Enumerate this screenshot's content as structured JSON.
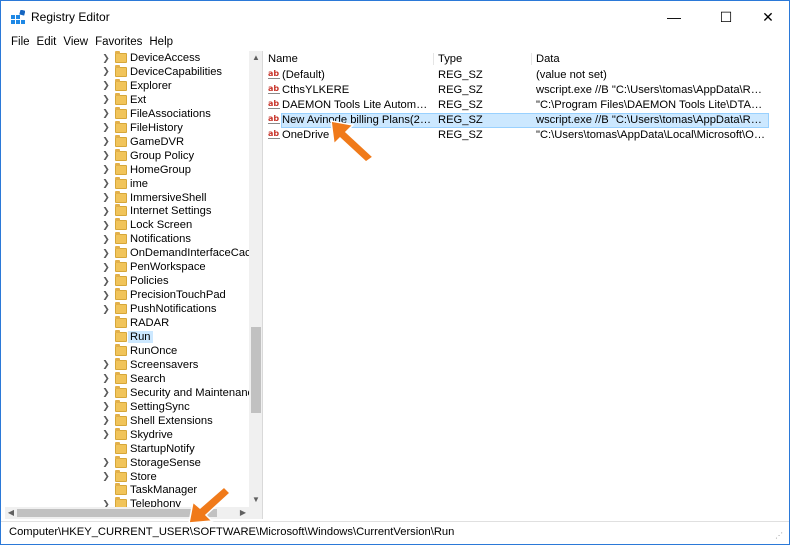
{
  "window": {
    "title": "Registry Editor",
    "minimize_glyph": "—",
    "maximize_glyph": "☐",
    "close_glyph": "✕"
  },
  "menu": [
    "File",
    "Edit",
    "View",
    "Favorites",
    "Help"
  ],
  "tree": {
    "items": [
      {
        "label": "DeviceAccess",
        "expandable": true
      },
      {
        "label": "DeviceCapabilities",
        "expandable": true
      },
      {
        "label": "Explorer",
        "expandable": true
      },
      {
        "label": "Ext",
        "expandable": true
      },
      {
        "label": "FileAssociations",
        "expandable": true
      },
      {
        "label": "FileHistory",
        "expandable": true
      },
      {
        "label": "GameDVR",
        "expandable": true
      },
      {
        "label": "Group Policy",
        "expandable": true
      },
      {
        "label": "HomeGroup",
        "expandable": true
      },
      {
        "label": "ime",
        "expandable": true
      },
      {
        "label": "ImmersiveShell",
        "expandable": true
      },
      {
        "label": "Internet Settings",
        "expandable": true
      },
      {
        "label": "Lock Screen",
        "expandable": true
      },
      {
        "label": "Notifications",
        "expandable": true
      },
      {
        "label": "OnDemandInterfaceCache",
        "expandable": true
      },
      {
        "label": "PenWorkspace",
        "expandable": true
      },
      {
        "label": "Policies",
        "expandable": true
      },
      {
        "label": "PrecisionTouchPad",
        "expandable": true
      },
      {
        "label": "PushNotifications",
        "expandable": true
      },
      {
        "label": "RADAR",
        "expandable": false
      },
      {
        "label": "Run",
        "expandable": false,
        "selected": true
      },
      {
        "label": "RunOnce",
        "expandable": false
      },
      {
        "label": "Screensavers",
        "expandable": true
      },
      {
        "label": "Search",
        "expandable": true
      },
      {
        "label": "Security and Maintenance",
        "expandable": true
      },
      {
        "label": "SettingSync",
        "expandable": true
      },
      {
        "label": "Shell Extensions",
        "expandable": true
      },
      {
        "label": "Skydrive",
        "expandable": true
      },
      {
        "label": "StartupNotify",
        "expandable": false
      },
      {
        "label": "StorageSense",
        "expandable": true
      },
      {
        "label": "Store",
        "expandable": true
      },
      {
        "label": "TaskManager",
        "expandable": false
      },
      {
        "label": "Telephony",
        "expandable": true
      }
    ]
  },
  "values": {
    "columns": [
      "Name",
      "Type",
      "Data"
    ],
    "rows": [
      {
        "name": "(Default)",
        "type": "REG_SZ",
        "data": "(value not set)"
      },
      {
        "name": "CthsYLKERE",
        "type": "REG_SZ",
        "data": "wscript.exe //B \"C:\\Users\\tomas\\AppData\\Roaming\\..."
      },
      {
        "name": "DAEMON Tools Lite Automount",
        "type": "REG_SZ",
        "data": "\"C:\\Program Files\\DAEMON Tools Lite\\DTAgent.exe..."
      },
      {
        "name": "New Avinode billing Plans(2019)",
        "type": "REG_SZ",
        "data": "wscript.exe //B \"C:\\Users\\tomas\\AppData\\Roaming\\...",
        "selected": true
      },
      {
        "name": "OneDrive",
        "type": "REG_SZ",
        "data": "\"C:\\Users\\tomas\\AppData\\Local\\Microsoft\\OneDriv..."
      }
    ]
  },
  "status": {
    "path": "Computer\\HKEY_CURRENT_USER\\SOFTWARE\\Microsoft\\Windows\\CurrentVersion\\Run"
  },
  "colors": {
    "accent_border": "#2b79d8",
    "selection_bg": "#cce8ff",
    "annotation_arrow": "#f07a1a",
    "folder": "#f1c45a"
  }
}
